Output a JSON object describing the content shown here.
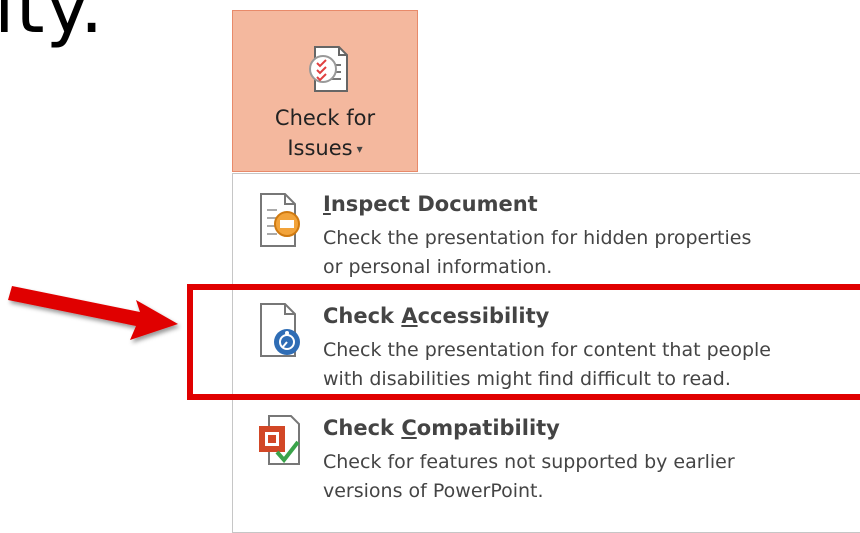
{
  "heading_fragment": "ity.",
  "ribbon_button": {
    "label_line1": "Check for",
    "label_line2": "Issues",
    "caret": "▾",
    "icon": "checklist-document-icon"
  },
  "menu": {
    "items": [
      {
        "title": "Inspect Document",
        "accelerator_letter": "I",
        "rest": "nspect Document",
        "description_line1": "Check the presentation for hidden properties",
        "description_line2": "or personal information.",
        "icon": "inspect-document-icon"
      },
      {
        "title": "Check Accessibility",
        "prefix": "Check ",
        "accelerator_letter": "A",
        "rest": "ccessibility",
        "description_line1": "Check the presentation for content that people",
        "description_line2": "with disabilities might find difficult to read.",
        "icon": "accessibility-check-icon"
      },
      {
        "title": "Check Compatibility",
        "prefix": "Check ",
        "accelerator_letter": "C",
        "rest": "ompatibility",
        "description_line1": "Check for features not supported by earlier",
        "description_line2": "versions of PowerPoint.",
        "icon": "compatibility-check-icon"
      }
    ]
  },
  "colors": {
    "button_bg": "#f4b89e",
    "highlight": "#e00000",
    "text": "#444444"
  }
}
